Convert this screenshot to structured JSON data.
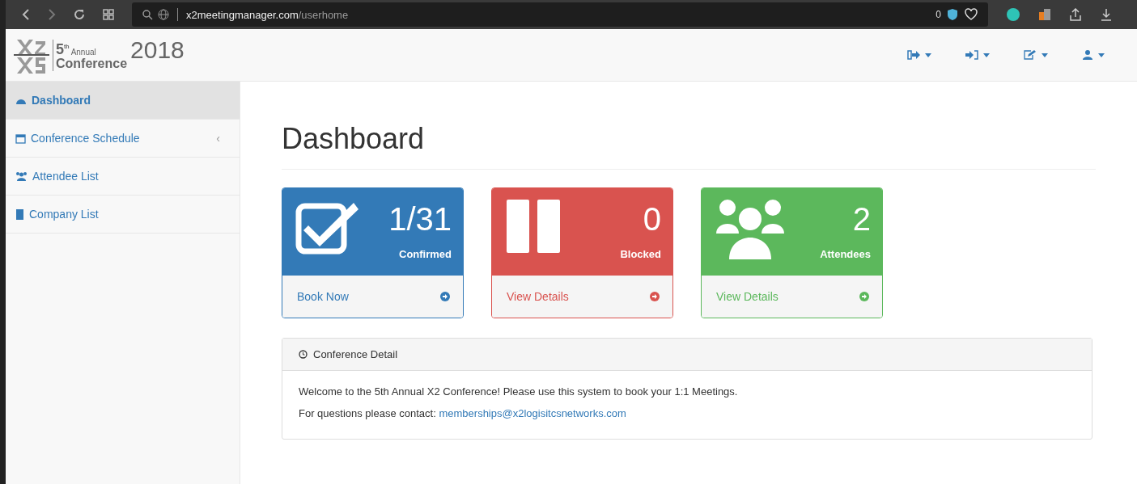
{
  "browser": {
    "url_host": "x2meetingmanager.com",
    "url_path": "/userhome",
    "badge_count": "0"
  },
  "logo": {
    "edition": "5",
    "edition_suffix": "th",
    "annual": "Annual",
    "conference": "Conference",
    "year": "2018"
  },
  "header_menus": [
    {
      "kind": "exit"
    },
    {
      "kind": "enter"
    },
    {
      "kind": "edit"
    },
    {
      "kind": "user"
    }
  ],
  "sidebar": {
    "items": [
      {
        "label": "Dashboard",
        "kind": "dashboard",
        "selected": true
      },
      {
        "label": "Conference Schedule",
        "kind": "calendar",
        "selected": false,
        "expand_glyph": "‹"
      },
      {
        "label": "Attendee List",
        "kind": "users",
        "selected": false
      },
      {
        "label": "Company List",
        "kind": "building",
        "selected": false
      }
    ]
  },
  "page_title": "Dashboard",
  "cards": [
    {
      "kind": "confirmed",
      "color": "#337ab7",
      "value": "1/31",
      "caption": "Confirmed",
      "link": "Book Now"
    },
    {
      "kind": "blocked",
      "color": "#d9534f",
      "value": "0",
      "caption": "Blocked",
      "link": "View Details"
    },
    {
      "kind": "attendees",
      "color": "#5cb85c",
      "value": "2",
      "caption": "Attendees",
      "link": "View Details"
    }
  ],
  "panel": {
    "title": "Conference Detail",
    "welcome": "Welcome to the 5th Annual X2 Conference! Please use this system to book your 1:1 Meetings.",
    "contact_label": "For questions please contact:",
    "contact_email": "memberships@x2logisitcsnetworks.com"
  }
}
